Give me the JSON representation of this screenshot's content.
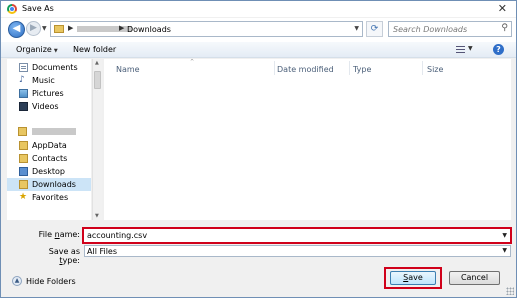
{
  "window": {
    "title": "Save As",
    "close_glyph": "✕"
  },
  "address": {
    "current_folder": "Downloads",
    "search_placeholder": "Search Downloads"
  },
  "toolbar": {
    "organize_label": "Organize",
    "new_folder_label": "New folder"
  },
  "nav": {
    "libraries": [
      {
        "label": "Documents",
        "icon": "documents-icon"
      },
      {
        "label": "Music",
        "icon": "music-icon"
      },
      {
        "label": "Pictures",
        "icon": "pictures-icon"
      },
      {
        "label": "Videos",
        "icon": "videos-icon"
      }
    ],
    "user_folders": [
      {
        "label": "AppData",
        "icon": "folder-icon"
      },
      {
        "label": "Contacts",
        "icon": "contacts-icon"
      },
      {
        "label": "Desktop",
        "icon": "desktop-icon"
      },
      {
        "label": "Downloads",
        "icon": "downloads-icon",
        "selected": true
      },
      {
        "label": "Favorites",
        "icon": "favorites-icon"
      }
    ]
  },
  "file_list": {
    "columns": [
      "Name",
      "Date modified",
      "Type",
      "Size"
    ]
  },
  "form": {
    "file_name_label_pre": "File ",
    "file_name_label_ul": "n",
    "file_name_label_post": "ame:",
    "file_name_value": "accounting.csv",
    "save_type_label_pre": "Save as ",
    "save_type_label_ul": "t",
    "save_type_label_post": "ype:",
    "save_type_value": "All Files"
  },
  "footer": {
    "hide_folders_label": "Hide Folders",
    "save_label_ul": "S",
    "save_label_post": "ave",
    "cancel_label": "Cancel"
  },
  "colors": {
    "highlight_border": "#d0001a",
    "selected_row": "#cce4f7",
    "accent": "#2f6ec8"
  }
}
